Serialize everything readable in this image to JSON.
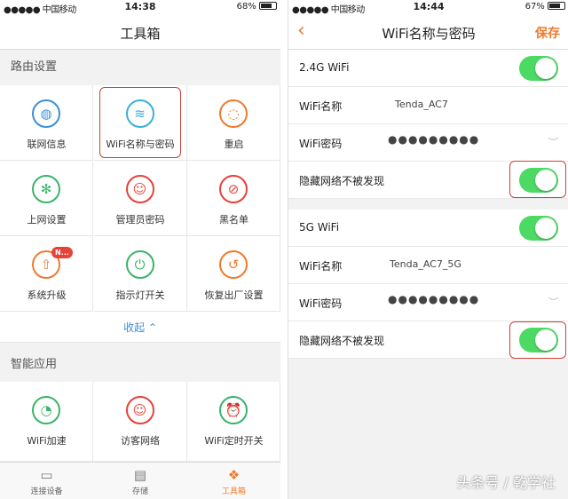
{
  "left": {
    "status": {
      "carrier": "●●●●● 中国移动",
      "time": "14:38",
      "battery": "68%",
      "battery_level": 0.68
    },
    "title": "工具箱",
    "section1": "路由设置",
    "tools": [
      {
        "label": "联网信息",
        "icon": "globe-icon",
        "color": "#3a8fd9",
        "glyph": "◍"
      },
      {
        "label": "WiFi名称与密码",
        "icon": "wifi-icon",
        "color": "#3ab0d9",
        "glyph": "≋"
      },
      {
        "label": "重启",
        "icon": "restart-icon",
        "color": "#f07a2c",
        "glyph": "◌"
      },
      {
        "label": "上网设置",
        "icon": "settings-icon",
        "color": "#3bb36b",
        "glyph": "✻"
      },
      {
        "label": "管理员密码",
        "icon": "admin-icon",
        "color": "#e8413a",
        "glyph": "☺"
      },
      {
        "label": "黑名单",
        "icon": "blacklist-icon",
        "color": "#e8413a",
        "glyph": "⊘"
      },
      {
        "label": "系统升级",
        "icon": "upgrade-icon",
        "color": "#f07a2c",
        "glyph": "⇧",
        "badge": "N..."
      },
      {
        "label": "指示灯开关",
        "icon": "indicator-light-icon",
        "color": "#3bb36b",
        "glyph": "⏻"
      },
      {
        "label": "恢复出厂设置",
        "icon": "reset-icon",
        "color": "#f07a2c",
        "glyph": "↺"
      }
    ],
    "collapse": "收起 ⌃",
    "section2": "智能应用",
    "apps": [
      {
        "label": "WiFi加速",
        "icon": "speedometer-icon",
        "color": "#3bb36b",
        "glyph": "◔"
      },
      {
        "label": "访客网络",
        "icon": "guest-icon",
        "color": "#e8413a",
        "glyph": "☺"
      },
      {
        "label": "WiFi定时开关",
        "icon": "alarm-clock-icon",
        "color": "#3bb36b",
        "glyph": "⏰"
      }
    ],
    "tabs": [
      {
        "label": "连接设备",
        "icon": "monitor-icon",
        "glyph": "▭"
      },
      {
        "label": "存储",
        "icon": "storage-icon",
        "glyph": "▤"
      },
      {
        "label": "工具箱",
        "icon": "toolbox-icon",
        "glyph": "❖"
      }
    ]
  },
  "right": {
    "status": {
      "carrier": "●●●●● 中国移动",
      "time": "14:44",
      "battery": "67%",
      "battery_level": 0.67
    },
    "title": "WiFi名称与密码",
    "save": "保存",
    "band24": {
      "label": "2.4G WiFi",
      "enabled": true,
      "name_label": "WiFi名称",
      "name_value": "Tenda_AC7",
      "pw_label": "WiFi密码",
      "pw_value": "●●●●●●●●●",
      "hide_label": "隐藏网络不被发现",
      "hide_enabled": true
    },
    "band5": {
      "label": "5G WiFi",
      "enabled": true,
      "name_label": "WiFi名称",
      "name_value": "Tenda_AC7_5G",
      "pw_label": "WiFi密码",
      "pw_value": "●●●●●●●●●",
      "hide_label": "隐藏网络不被发现",
      "hide_enabled": true
    }
  },
  "watermark": "头条号 / 乾学社",
  "colors": {
    "accent": "#f07a2c",
    "toggle_on": "#4cd964",
    "highlight": "#c9403a"
  }
}
